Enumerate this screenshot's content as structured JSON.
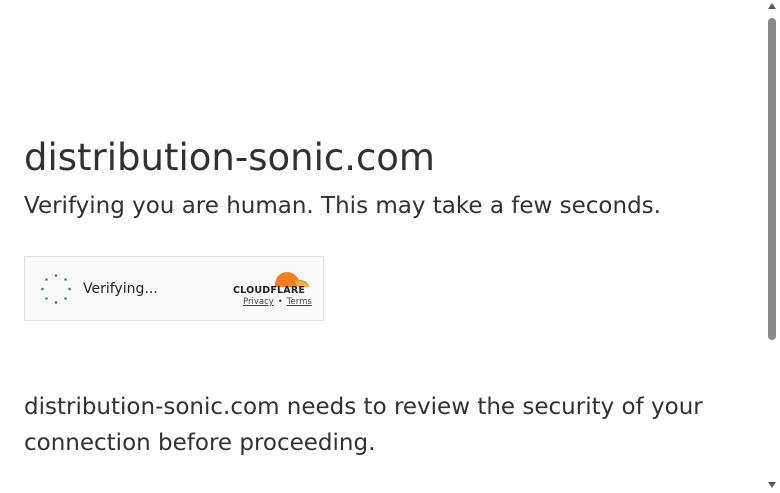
{
  "page": {
    "domain_title": "distribution-sonic.com",
    "verify_text": "Verifying you are human. This may take a few seconds.",
    "security_text": "distribution-sonic.com needs to review the security of your connection before proceeding."
  },
  "widget": {
    "status_label": "Verifying...",
    "brand": "CLOUDFLARE",
    "privacy_link": "Privacy",
    "separator": "•",
    "terms_link": "Terms",
    "spinner_color": "#2e9a3e"
  },
  "colors": {
    "text": "#313131",
    "widget_bg": "#fafafa",
    "widget_border": "#e0e0e0",
    "cloudflare_orange": "#f38020",
    "cloudflare_light_orange": "#faae40"
  }
}
